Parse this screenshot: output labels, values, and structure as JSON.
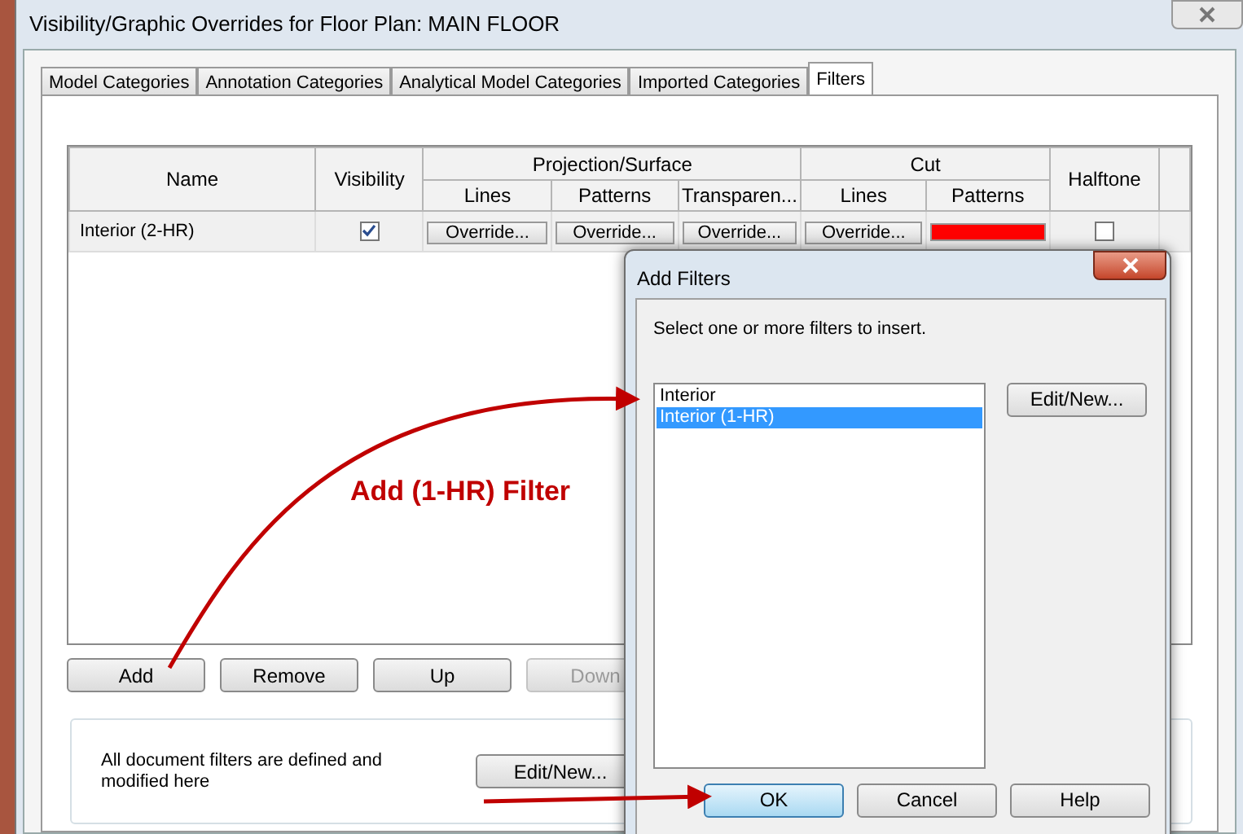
{
  "window": {
    "title": "Visibility/Graphic Overrides for Floor Plan: MAIN FLOOR"
  },
  "tabs": [
    {
      "label": "Model Categories",
      "selected": false
    },
    {
      "label": "Annotation Categories",
      "selected": false
    },
    {
      "label": "Analytical Model Categories",
      "selected": false
    },
    {
      "label": "Imported Categories",
      "selected": false
    },
    {
      "label": "Filters",
      "selected": true
    }
  ],
  "table": {
    "column_groups": [
      {
        "label": "Name"
      },
      {
        "label": "Visibility"
      },
      {
        "label": "Projection/Surface",
        "children": [
          "Lines",
          "Patterns",
          "Transparen..."
        ]
      },
      {
        "label": "Cut",
        "children": [
          "Lines",
          "Patterns"
        ]
      },
      {
        "label": "Halftone"
      }
    ],
    "rows": [
      {
        "name": "Interior (2-HR)",
        "visible": true,
        "cells": [
          {
            "kind": "button",
            "label": "Override..."
          },
          {
            "kind": "button",
            "label": "Override..."
          },
          {
            "kind": "button",
            "label": "Override..."
          },
          {
            "kind": "button",
            "label": "Override..."
          },
          {
            "kind": "swatch",
            "color": "#ff0000"
          }
        ],
        "halftone": false
      }
    ]
  },
  "buttons": [
    {
      "label": "Add",
      "disabled": false
    },
    {
      "label": "Remove",
      "disabled": false
    },
    {
      "label": "Up",
      "disabled": false
    },
    {
      "label": "Down",
      "disabled": true
    }
  ],
  "filters_note": {
    "text": "All document filters are defined and modified here",
    "button": "Edit/New..."
  },
  "add_filters_dialog": {
    "title": "Add Filters",
    "instruction": "Select one or more filters to insert.",
    "items": [
      {
        "label": "Interior",
        "selected": false
      },
      {
        "label": "Interior (1-HR)",
        "selected": true
      }
    ],
    "edit_button": "Edit/New...",
    "buttons": [
      {
        "label": "OK",
        "focused": true
      },
      {
        "label": "Cancel",
        "focused": false
      },
      {
        "label": "Help",
        "focused": false
      }
    ]
  },
  "annotation": {
    "text": "Add (1-HR) Filter"
  }
}
